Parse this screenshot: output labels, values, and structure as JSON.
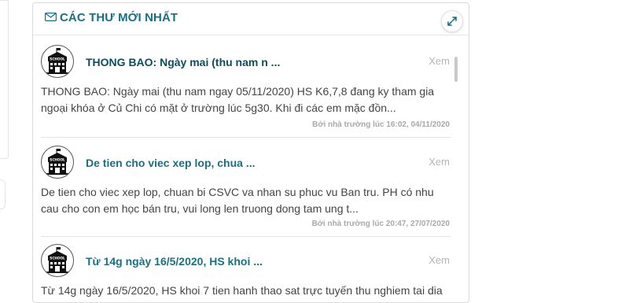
{
  "panel": {
    "title": "CÁC THƯ MỚI NHẤT",
    "icons": {
      "header": "envelope-icon",
      "expand": "expand-arrows-icon",
      "avatar": "school-building-icon"
    }
  },
  "messages": [
    {
      "title": "THONG BAO: Ngày mai (thu nam n ...",
      "view_label": "Xem",
      "body": "THONG BAO: Ngày mai (thu nam ngay 05/11/2020) HS K6,7,8 đang ky tham gia ngoại khóa ở Củ Chi có mặt ở trường lúc 5g30. Khi đi các em mặc đồn...",
      "meta": "Bởi nhà trường lúc 16:02, 04/11/2020"
    },
    {
      "title": "De tien cho viec xep lop, chua ...",
      "view_label": "Xem",
      "body": "De tien cho viec xep lop, chuan bi CSVC va nhan su phuc vu Ban tru. PH có nhu cau cho con em học bán tru, vui long len truong dong tam ung t...",
      "meta": "Bởi nhà trường lúc 20:47, 27/07/2020"
    },
    {
      "title": "Từ 14g ngày 16/5/2020, HS khoi ...",
      "view_label": "Xem",
      "body": "Từ 14g ngày 16/5/2020, HS khoi 7 tien hanh thao sat trực tuyến thu nghiem tai dia",
      "meta": ""
    }
  ],
  "avatar_label": "SCHOOL"
}
